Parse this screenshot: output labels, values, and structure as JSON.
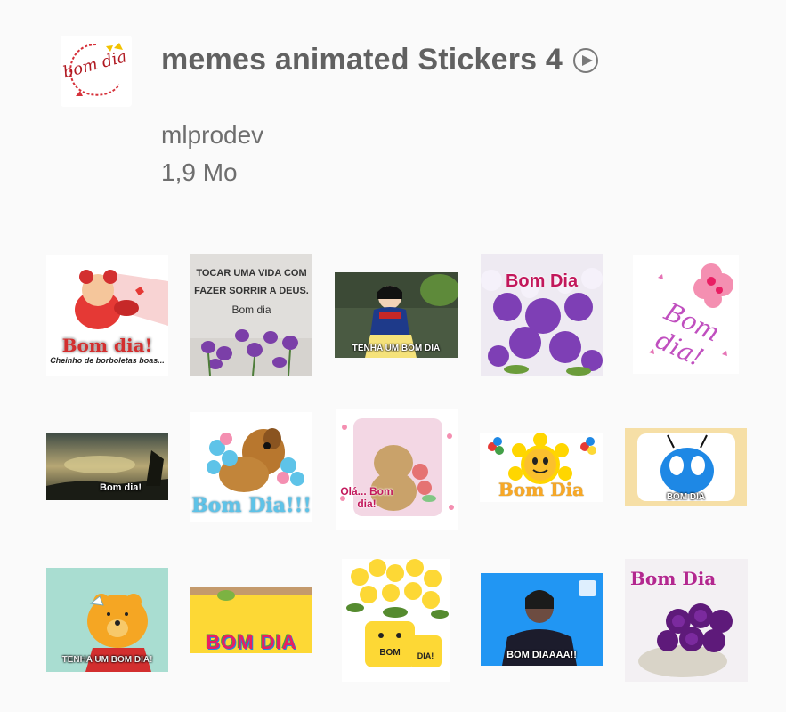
{
  "pack": {
    "title": "memes animated Stickers 4",
    "author": "mlprodev",
    "size": "1,9 Mo",
    "icon_text": "bom dia"
  },
  "icons": {
    "play": "play-circle-icon"
  },
  "stickers": [
    {
      "id": "s1",
      "caption": "Bom dia!",
      "sub": "Cheinho de borboletas boas..."
    },
    {
      "id": "s2",
      "caption": "TOCAR UMA VIDA COM",
      "sub": "FAZER SORRIR A DEUS.",
      "extra": "Bom dia"
    },
    {
      "id": "s3",
      "caption": "TENHA UM BOM DIA"
    },
    {
      "id": "s4",
      "caption": "Bom Dia"
    },
    {
      "id": "s5",
      "caption": "Bom dia!"
    },
    {
      "id": "s6",
      "caption": "Bom dia!"
    },
    {
      "id": "s7",
      "caption": "Bom Dia!!!"
    },
    {
      "id": "s8",
      "caption": "Olá... Bom dia!"
    },
    {
      "id": "s9",
      "caption": "Bom Dia"
    },
    {
      "id": "s10",
      "caption": "BOM DIA"
    },
    {
      "id": "s11",
      "caption": "TENHA UM BOM DIA!"
    },
    {
      "id": "s12",
      "caption": "BOM DIA"
    },
    {
      "id": "s13",
      "caption": "BOM",
      "sub": "DIA!"
    },
    {
      "id": "s14",
      "caption": "BOM DIAAAA!!"
    },
    {
      "id": "s15",
      "caption": "Bom Dia"
    }
  ]
}
